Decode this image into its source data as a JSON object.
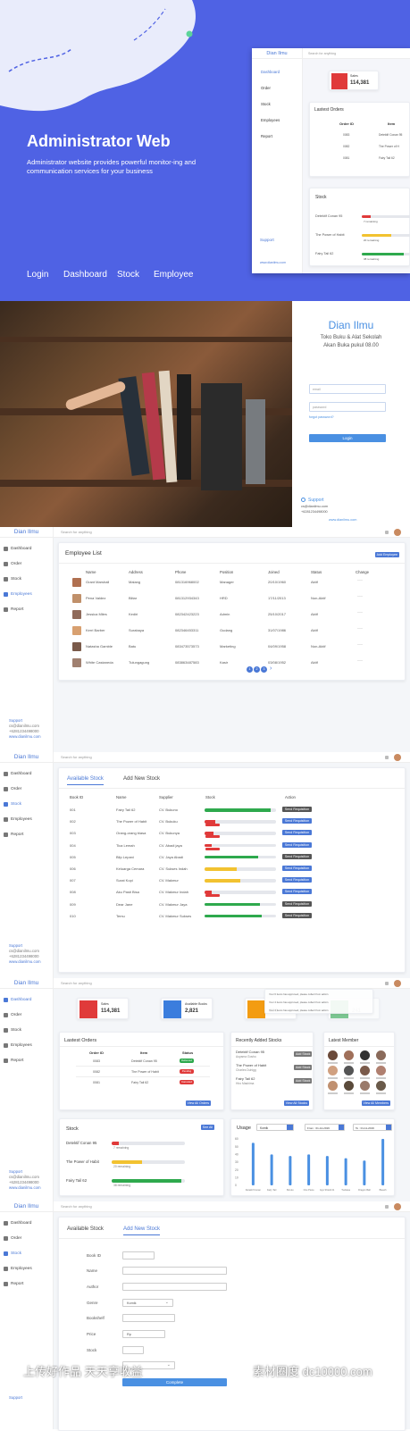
{
  "hero": {
    "title": "Administrator Web",
    "subtitle": "Administrator website provides powerful monitor-ing and communication services for your business",
    "nav": [
      "Login",
      "Dashboard",
      "Stock",
      "Employee"
    ],
    "preview": {
      "brand": "Dian Ilmu",
      "search": "Search for anything",
      "menu": [
        "Dashboard",
        "Order",
        "Stock",
        "Employees",
        "Report"
      ],
      "sales_label": "Sales",
      "sales_value": "114,381",
      "orders_title": "Lastest Orders",
      "orders_cols": [
        "Order ID",
        "Item"
      ],
      "orders": [
        [
          "0083",
          "Detektif Conan 95"
        ],
        [
          "0082",
          "The Power of H"
        ],
        [
          "0081",
          "Fairy Tail 62"
        ]
      ],
      "stock_title": "Stock",
      "stock": [
        {
          "name": "Detektif Conan 95",
          "note": "7 remaining"
        },
        {
          "name": "The Power of Habit",
          "note": "20 remaining"
        },
        {
          "name": "Fairy Tail 62",
          "note": "38 remaining"
        }
      ],
      "support": "Support",
      "email": "www.dianilmu.com"
    }
  },
  "login": {
    "brand": "Dian Ilmu",
    "tagline1": "Toko Buku & Alat Sekolah",
    "tagline2": "Akan Buka pukul 08.00",
    "email_ph": "email",
    "password_ph": "password",
    "forgot": "forgot password?",
    "button": "Login",
    "support": "Support",
    "contact1": "cs@dianilmu.com",
    "contact2": "+6281234498000",
    "site": "www.dianilmu.com"
  },
  "common": {
    "brand": "Dian Ilmu",
    "search": "Search for anything",
    "menu": [
      "Dashboard",
      "Order",
      "Stock",
      "Employees",
      "Report"
    ],
    "support": "Support",
    "contact1": "cs@dianilmu.com",
    "contact2": "+6281234498000",
    "site": "www.dianilmu.com"
  },
  "employees": {
    "title": "Employee List",
    "add": "Add Employee",
    "cols": [
      "Name",
      "Address",
      "Phone",
      "Position",
      "Joined",
      "Status",
      "Change"
    ],
    "rows": [
      [
        "Grant Marshall",
        "Malang",
        "081316968002",
        "Manager",
        "20/10/1960",
        "Aktif"
      ],
      [
        "Pena Valdez",
        "Blitar",
        "081312934343",
        "HRD",
        "17/11/2013",
        "Non-Aktif"
      ],
      [
        "Jessica Miles",
        "Kediri",
        "082342423223",
        "Admin",
        "25/10/2017",
        "Aktif"
      ],
      [
        "Kerri Barber",
        "Surabaya",
        "082346453311",
        "Gudang",
        "31/07/1986",
        "Aktif"
      ],
      [
        "Natasha Gamble",
        "Batu",
        "083473573573",
        "Marketing",
        "04/09/1958",
        "Non-Aktif"
      ],
      [
        "White Castaneda",
        "Tulungagung",
        "083863487583",
        "Kasir",
        "03/08/1952",
        "Aktif"
      ]
    ],
    "pages": [
      "1",
      "2",
      "3"
    ]
  },
  "stock": {
    "tabs": [
      "Available Stock",
      "Add New Stock"
    ],
    "cols": [
      "Book ID",
      "Name",
      "Supplier",
      "Stock",
      "Action"
    ],
    "action": "Send Requisition",
    "rows": [
      [
        "001",
        "Fairy Tail 62",
        "CV. Bukuno",
        0.92,
        "#2ea94d"
      ],
      [
        "002",
        "The Power of Habit",
        "CV. Bukuku",
        0.15,
        "#e03a3a"
      ],
      [
        "003",
        "Orang-orang biasa",
        "CV. Bukunya",
        0.12,
        "#e03a3a"
      ],
      [
        "004",
        "Tica Lemah",
        "CV. Abadi jaya",
        0.1,
        "#e03a3a"
      ],
      [
        "005",
        "Blip Lepani",
        "CV. Jaya Abadi",
        0.75,
        "#2ea94d"
      ],
      [
        "006",
        "Keluarga Cemara",
        "CV. Sukses Indah",
        0.45,
        "#f2c230"
      ],
      [
        "007",
        "Surat Kopi",
        "CV. Makmur",
        0.5,
        "#f2c230"
      ],
      [
        "008",
        "Aku Pasti Bisa",
        "CV. Makmur Indah",
        0.1,
        "#e03a3a"
      ],
      [
        "009",
        "Dear Jane",
        "CV. Makmur Jaya",
        0.78,
        "#2ea94d"
      ],
      [
        "010",
        "Temu",
        "CV. Makmur Sukses",
        0.8,
        "#2ea94d"
      ]
    ]
  },
  "dashboard": {
    "cards": [
      {
        "label": "Sales",
        "value": "114,381",
        "color": "#e03a3a"
      },
      {
        "label": "Available Books",
        "value": "2,821",
        "color": "#3b7ddd"
      },
      {
        "label": "",
        "value": "893",
        "color": "#f39c12"
      },
      {
        "label": "",
        "value": "241",
        "color": "#2ea94d"
      }
    ],
    "notice": [
      "Your 6 items has approved, please collect from admin",
      "Your 4 items has approved, please collect from admin",
      "Your 4 items has approved, please collect from admin"
    ],
    "orders": {
      "title": "Lastest Orders",
      "cols": [
        "Order ID",
        "Item",
        "Status"
      ],
      "rows": [
        [
          "0083",
          "Detektif Conan 95",
          "Delivered"
        ],
        [
          "0082",
          "The Power of Habit",
          "Pending"
        ],
        [
          "0081",
          "Fairy Tail 62",
          "Canceled"
        ]
      ],
      "btn": "View All Orders"
    },
    "recent": {
      "title": "Recently Added Stocks",
      "rows": [
        [
          "Detektif Conan 95",
          "Aoyama Gosho"
        ],
        [
          "The Power of Habit",
          "Charles Duhigg"
        ],
        [
          "Fairy Tail 62",
          "Hiro Mashima"
        ]
      ],
      "add": "Add Stock",
      "btn": "View All Stocks"
    },
    "members": {
      "title": "Latest Member",
      "btn": "View All Members"
    },
    "stock": {
      "title": "Stock",
      "btn": "See All",
      "rows": [
        {
          "name": "Detektif Conan 95",
          "note": "7 remaining",
          "pct": 0.1,
          "color": "#e03a3a"
        },
        {
          "name": "The Power of Habit",
          "note": "20 remaining",
          "pct": 0.42,
          "color": "#f2c230"
        },
        {
          "name": "Fairy Tail 62",
          "note": "38 remaining",
          "pct": 0.95,
          "color": "#2ea94d"
        }
      ]
    },
    "usage": {
      "title": "Usage",
      "filter": "Komik",
      "from": "From : 01-12-2019",
      "to": "To : 01-11-2019"
    }
  },
  "chart_data": {
    "type": "bar",
    "title": "Usage",
    "categories": [
      "Detektif Conan",
      "Fairy Tail",
      "Boruto",
      "One Piece",
      "Eye Shield 21",
      "Tsubasa",
      "Dragon Ball",
      "Bleach"
    ],
    "values": [
      55,
      40,
      38,
      40,
      38,
      35,
      32,
      60
    ],
    "ylim": [
      0,
      60
    ],
    "yticks": [
      "60",
      "50",
      "40",
      "30",
      "20",
      "10",
      "0"
    ],
    "color": "#4a90e2"
  },
  "addstock": {
    "tabs": [
      "Available Stock",
      "Add New Stock"
    ],
    "fields": [
      "Book ID",
      "Name",
      "Author",
      "Genre",
      "Bookshelf",
      "Price",
      "Stock"
    ],
    "genre": "Komik",
    "price_ph": "Rp",
    "button": "Complete"
  },
  "watermark": {
    "left": "上传好作品 天天享收益",
    "right": "素材圈度 dc10000.com"
  }
}
